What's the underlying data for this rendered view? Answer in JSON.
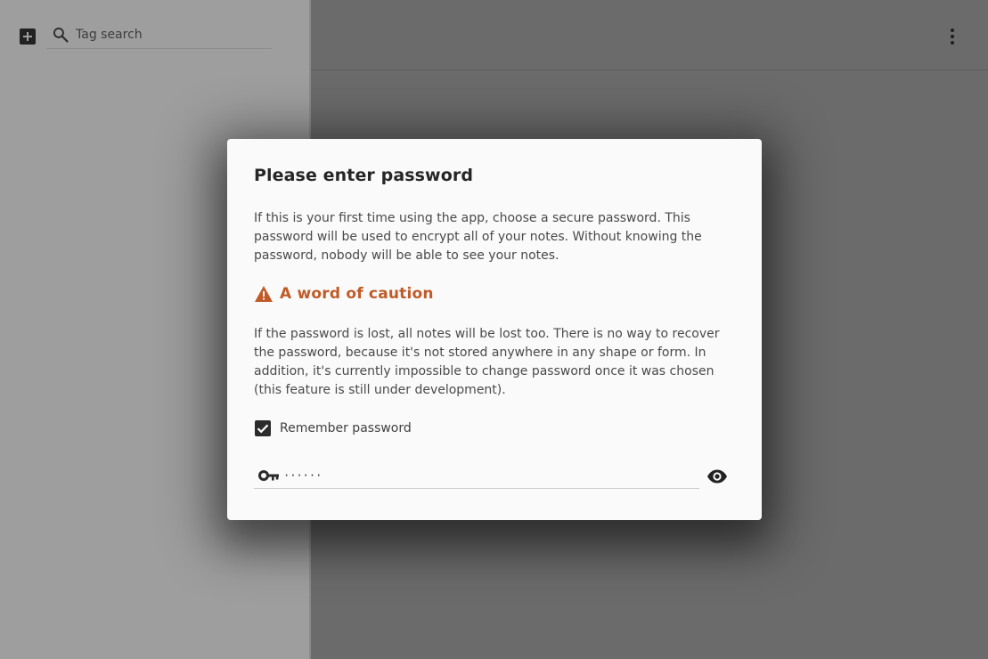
{
  "sidebar": {
    "add_icon": "add-box-icon",
    "search": {
      "icon": "search-icon",
      "placeholder": "Tag search",
      "value": ""
    }
  },
  "header": {
    "menu_icon": "more-vert-icon"
  },
  "dialog": {
    "title": "Please enter password",
    "intro": "If this is your first time using the app, choose a secure password. This password will be used to encrypt all of your notes. Without knowing the password, nobody will be able to see your notes.",
    "caution": {
      "icon": "warning-icon",
      "heading": "A word of caution",
      "color": "#c05a28",
      "body": "If the password is lost, all notes will be lost too. There is no way to recover the password, because it's not stored anywhere in any shape or form. In addition, it's currently impossible to change password once it was chosen (this feature is still under development)."
    },
    "remember": {
      "label": "Remember password",
      "checked": true
    },
    "password": {
      "icon": "key-icon",
      "masked_value": "······",
      "visibility_icon": "eye-icon"
    }
  }
}
